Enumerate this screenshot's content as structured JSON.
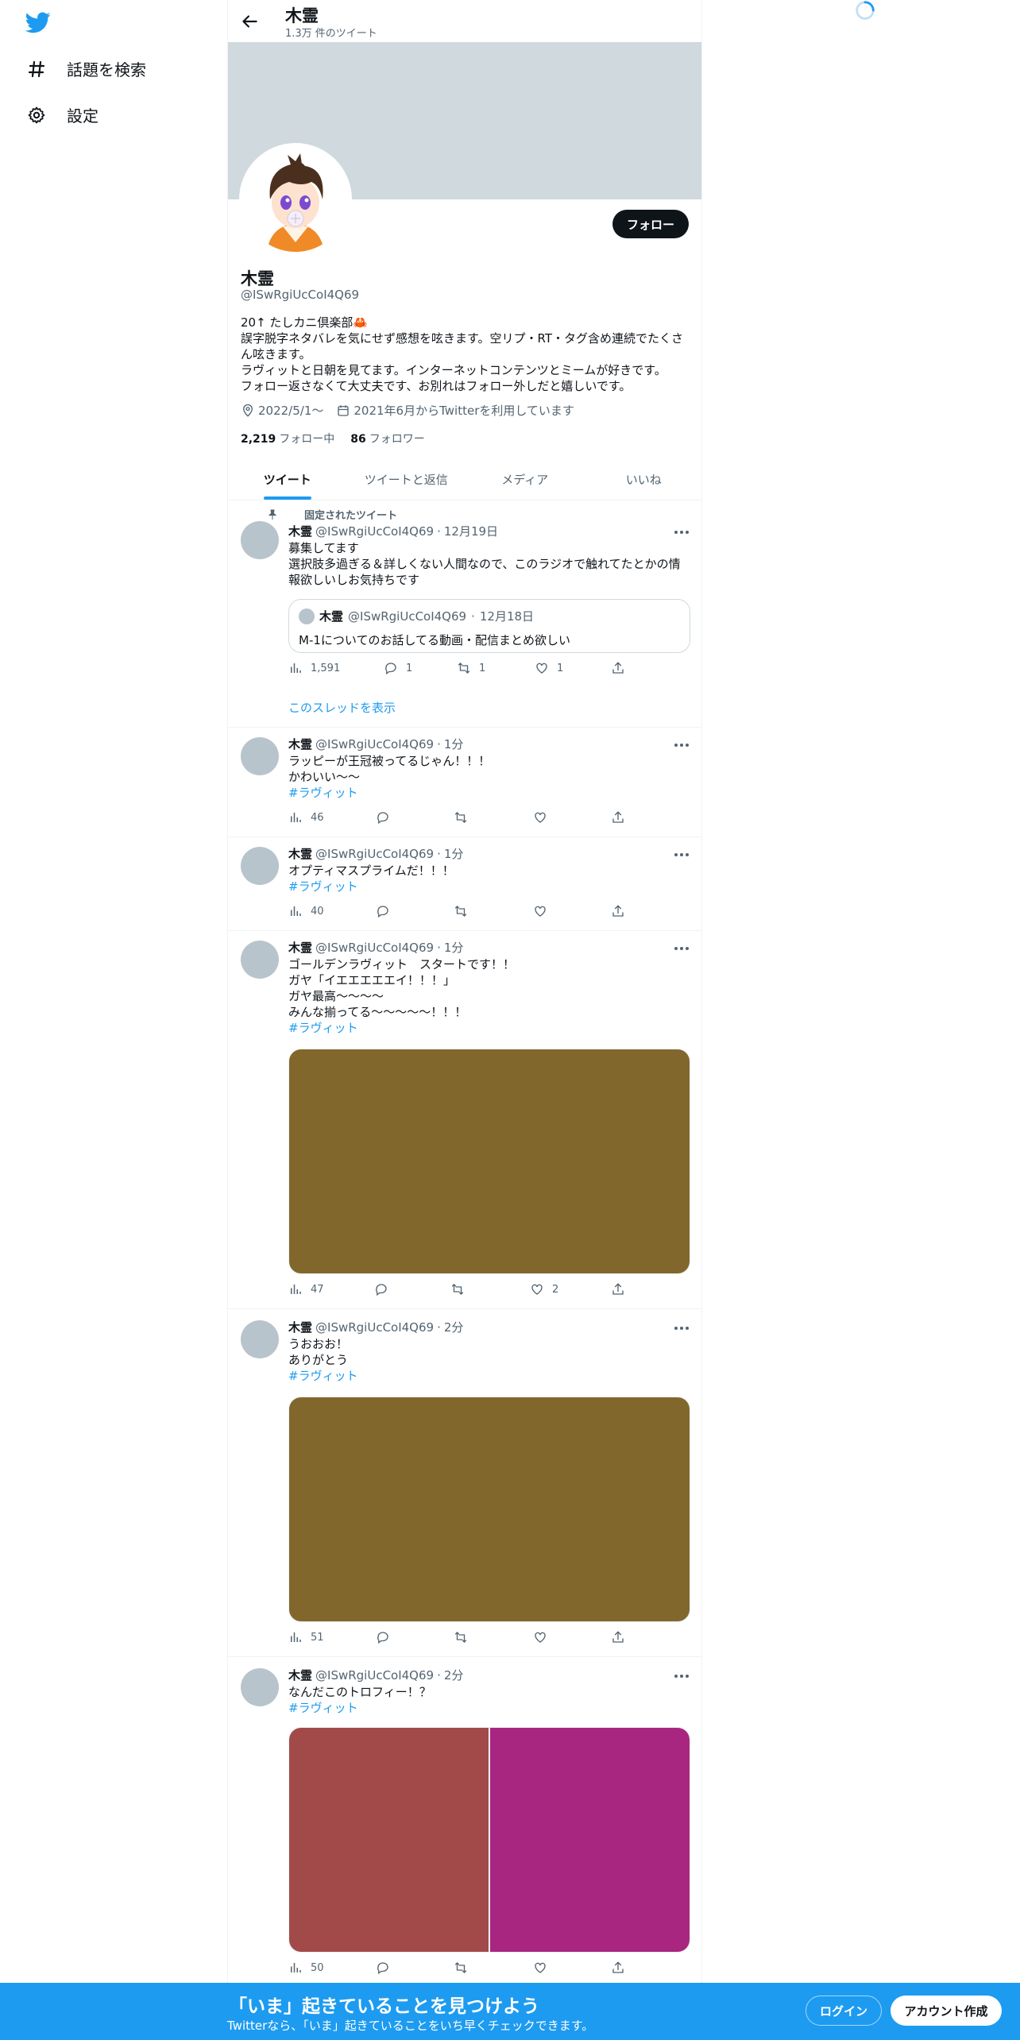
{
  "nav": {
    "logo": "twitter-bird-icon",
    "items": [
      {
        "label": "話題を検索",
        "icon": "hashtag-icon"
      },
      {
        "label": "設定",
        "icon": "gear-icon"
      }
    ]
  },
  "header": {
    "name": "木霊",
    "tweet_count": "1.3万 件のツイート"
  },
  "profile": {
    "name": "木霊",
    "handle": "@ISwRgiUcCoI4Q69",
    "follow_label": "フォロー",
    "bio": [
      "20↑ たしカニ倶楽部🦀",
      "誤字脱字ネタバレを気にせず感想を呟きます。空リプ・RT・タグ含め連続でたくさん呟きます。",
      "ラヴィットと日朝を見てます。インターネットコンテンツとミームが好きです。",
      "フォロー返さなくて大丈夫です、お別れはフォロー外しだと嬉しいです。"
    ],
    "location": "2022/5/1～",
    "joined": "2021年6月からTwitterを利用しています",
    "following_count": "2,219",
    "following_label": "フォロー中",
    "followers_count": "86",
    "followers_label": "フォロワー"
  },
  "tabs": [
    "ツイート",
    "ツイートと返信",
    "メディア",
    "いいね"
  ],
  "pinned_label": "固定されたツイート",
  "tweets": [
    {
      "name": "木霊",
      "handle": "@ISwRgiUcCoI4Q69",
      "time": "12月19日",
      "lines": [
        "募集してます",
        "選択肢多過ぎる＆詳しくない人間なので、このラジオで触れてたとかの情報欲しいしお気持ちです"
      ],
      "quote": {
        "name": "木霊",
        "handle": "@ISwRgiUcCoI4Q69",
        "time": "12月18日",
        "text": "M-1についてのお話してる動画・配信まとめ欲しい"
      },
      "views": "1,591",
      "replies": "1",
      "retweets": "1",
      "likes": "1",
      "thread_label": "このスレッドを表示"
    },
    {
      "name": "木霊",
      "handle": "@ISwRgiUcCoI4Q69",
      "time": "1分",
      "lines": [
        "ラッピーが王冠被ってるじゃん！！！",
        "かわいい～～"
      ],
      "hashtag": "#ラヴィット",
      "views": "46"
    },
    {
      "name": "木霊",
      "handle": "@ISwRgiUcCoI4Q69",
      "time": "1分",
      "lines": [
        "オプティマスプライムだ！！！"
      ],
      "hashtag": "#ラヴィット",
      "views": "40"
    },
    {
      "name": "木霊",
      "handle": "@ISwRgiUcCoI4Q69",
      "time": "1分",
      "lines": [
        "ゴールデンラヴィット　スタートです！！",
        "ガヤ「イエエエエエイ！！！」",
        "ガヤ最高～～～～",
        "みんな揃ってる～～～～～！！！"
      ],
      "hashtag": "#ラヴィット",
      "media_color": "#82672d",
      "views": "47",
      "likes": "2"
    },
    {
      "name": "木霊",
      "handle": "@ISwRgiUcCoI4Q69",
      "time": "2分",
      "lines": [
        "うおおお！",
        "ありがとう"
      ],
      "hashtag": "#ラヴィット",
      "media_color": "#82672d",
      "views": "51"
    },
    {
      "name": "木霊",
      "handle": "@ISwRgiUcCoI4Q69",
      "time": "2分",
      "lines": [
        "なんだこのトロフィー！？"
      ],
      "hashtag": "#ラヴィット",
      "media_colors": [
        "#a24a4a",
        "#a8267f"
      ],
      "views": "50"
    }
  ],
  "bottom": {
    "title": "「いま」起きていることを見つけよう",
    "subtitle": "Twitterなら、「いま」起きていることをいち早くチェックできます。",
    "login": "ログイン",
    "signup": "アカウント作成"
  },
  "colors": {
    "accent": "#1d9bf0",
    "text": "#0f1419",
    "muted": "#536471",
    "banner": "#cfd9de"
  }
}
